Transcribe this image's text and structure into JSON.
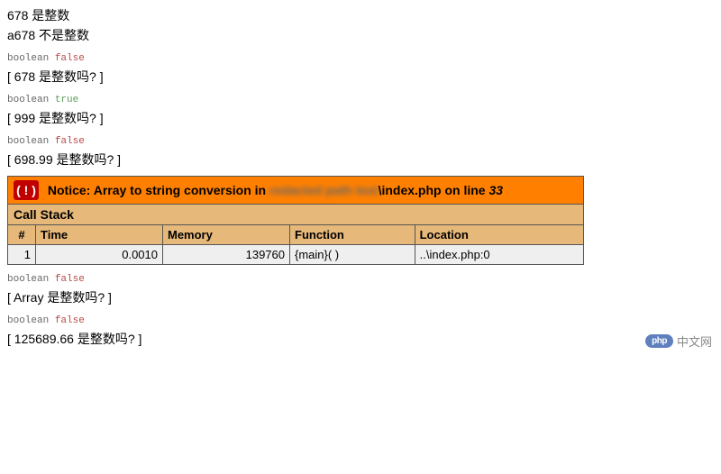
{
  "output": {
    "line1": "678 是整数",
    "line2": "a678 不是整数",
    "vardump1_type": "boolean",
    "vardump1_val": "false",
    "question1": "[ 678 是整数吗? ]",
    "vardump2_type": "boolean",
    "vardump2_val": "true",
    "question2": "[ 999 是整数吗? ]",
    "vardump3_type": "boolean",
    "vardump3_val": "false",
    "question3": "[ 698.99 是整数吗? ]",
    "vardump4_type": "boolean",
    "vardump4_val": "false",
    "question4": "[ Array 是整数吗? ]",
    "vardump5_type": "boolean",
    "vardump5_val": "false",
    "question5": "[ 125689.66 是整数吗? ]"
  },
  "xdebug": {
    "exclaim": "( ! )",
    "notice_prefix": "Notice: Array to string conversion in ",
    "notice_blur": "redacted path text",
    "notice_suffix_pre": "\\index.php on line ",
    "notice_line": "33",
    "callstack_label": "Call Stack",
    "cols": {
      "num": "#",
      "time": "Time",
      "memory": "Memory",
      "function": "Function",
      "location": "Location"
    },
    "row": {
      "num": "1",
      "time": "0.0010",
      "memory": "139760",
      "function": "{main}( )",
      "location": "..\\index.php:0"
    }
  },
  "watermark": {
    "badge": "php",
    "site": "中文网"
  }
}
